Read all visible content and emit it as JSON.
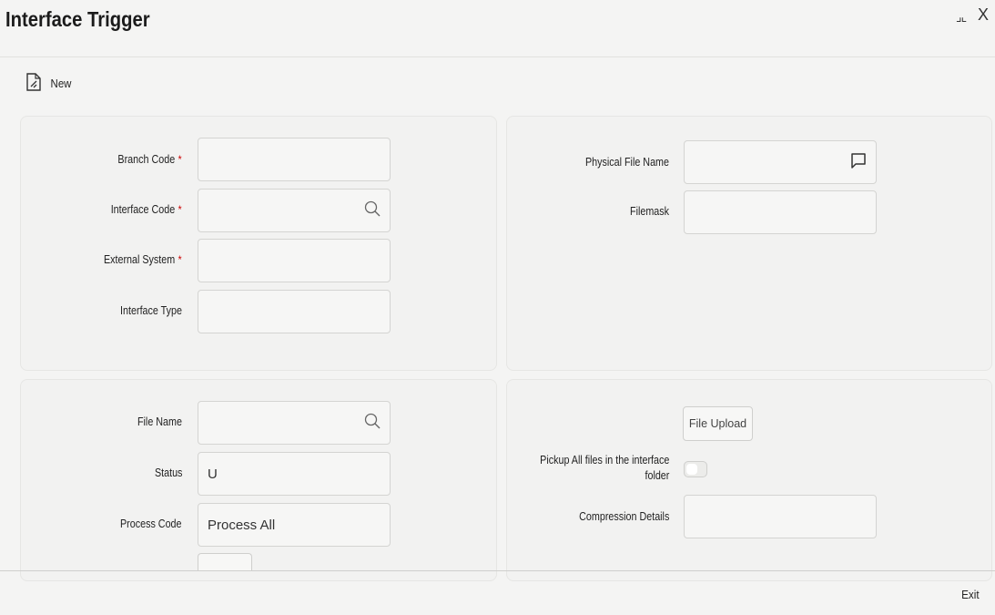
{
  "window": {
    "title": "Interface Trigger",
    "restore_glyph": "⠿",
    "close_glyph": "X"
  },
  "toolbar": {
    "new_label": "New",
    "new_icon": "new-document-icon"
  },
  "main": {
    "branch_code_label": "Branch Code",
    "interface_code_label": "Interface Code",
    "external_system_label": "External System",
    "interface_type_label": "Interface Type",
    "required_marker": "*",
    "branch_code_value": "",
    "interface_code_value": "",
    "external_system_value": "",
    "interface_type_value": "",
    "physical_file_name_label": "Physical File Name",
    "filemask_label": "Filemask",
    "physical_file_name_value": "",
    "filemask_value": ""
  },
  "file_section": {
    "file_name_label": "File Name",
    "file_name_value": "",
    "status_label": "Status",
    "status_value": "U",
    "process_code_label": "Process Code",
    "process_code_value": "Process All",
    "file_upload_label": "File Upload",
    "pickup_label_line1": "Pickup All files in the interface",
    "pickup_label_line2": "folder",
    "pickup_enabled": false,
    "compression_label": "Compression Details",
    "compression_value": ""
  },
  "footer": {
    "exit_label": "Exit"
  }
}
